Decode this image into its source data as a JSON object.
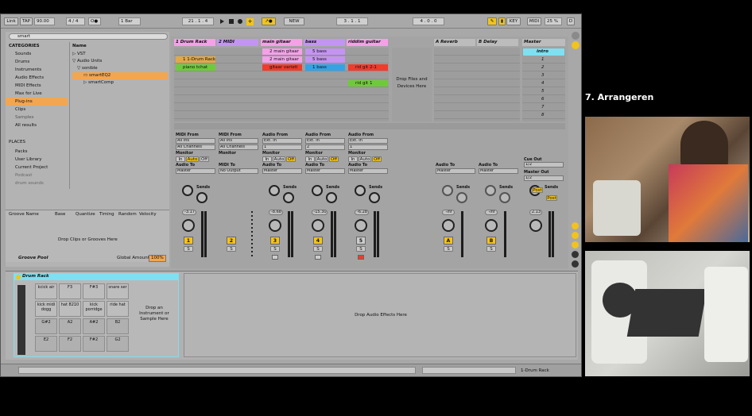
{
  "control_bar": {
    "link": "Link",
    "tap": "TAP",
    "tempo": "90.00",
    "signature": "4 / 4",
    "metronome": "O●",
    "quantize": "1 Bar",
    "position": "21 . 1 . 4",
    "loop_start": "3 . 1 . 1",
    "loop_len": "4 . 0 . 0",
    "new": "NEW",
    "key": "KEY",
    "midi": "MIDI",
    "cpu": "25 %",
    "d": "D"
  },
  "browser": {
    "search": "smart",
    "categories_header": "CATEGORIES",
    "categories": [
      "Sounds",
      "Drums",
      "Instruments",
      "Audio Effects",
      "MIDI Effects",
      "Max for Live",
      "Plug-ins",
      "Clips",
      "Samples",
      "All results"
    ],
    "selected_category": "Plug-ins",
    "places_header": "PLACES",
    "places": [
      "Packs",
      "User Library",
      "Current Project",
      "Podcast",
      "drum sounds"
    ],
    "name_header": "Name",
    "tree": [
      "▷ VST",
      "▽ Audio Units",
      "▽ sonible",
      "smartEQ2",
      "▷ smartComp"
    ],
    "selected_item": "smartEQ2"
  },
  "groove": {
    "headers": [
      "Groove Name",
      "Base",
      "Quantize",
      "Timing",
      "Random",
      "Velocity"
    ],
    "hint": "Drop Clips or Grooves Here",
    "pool": "Groove Pool",
    "global_amount": "Global Amount",
    "amount": "100%"
  },
  "tracks": [
    {
      "name": "1 Drum Rack",
      "color": "#f4a1e8",
      "clips": [
        "",
        "1 1-Drum Rack",
        "piano tchat",
        "",
        "",
        "",
        "",
        "",
        "",
        "",
        ""
      ],
      "clip_colors": [
        "",
        "#e0a848",
        "#6fca3a"
      ],
      "io_from": "All Ins",
      "channel": "All Channels",
      "to": "Master",
      "number": "1",
      "volume": "-3.17"
    },
    {
      "name": "2 MIDI",
      "color": "#c494f2",
      "clips": [],
      "io_from": "All Ins",
      "channel": "All Channels",
      "to": "No Output",
      "number": "2",
      "volume": ""
    },
    {
      "name": "main gitaar",
      "color": "#f4a1e8",
      "clips": [
        "2 main gitaar",
        "2 main gitaar",
        "gitaar varieti"
      ],
      "clip_colors": [
        "#f4a1e8",
        "#f4a1e8",
        "#f03b2d"
      ],
      "io_from": "Ext. In",
      "channel": "1",
      "to": "Master",
      "number": "3",
      "volume": "-8.68"
    },
    {
      "name": "bass",
      "color": "#c494f2",
      "clips": [
        "5 bass",
        "5 bass",
        "1 bass"
      ],
      "clip_colors": [
        "#c494f2",
        "#c494f2",
        "#33a3e6"
      ],
      "io_from": "Ext. In",
      "channel": "2",
      "to": "Master",
      "number": "4",
      "volume": "-15.30"
    },
    {
      "name": "riddim guitar",
      "color": "#f4a1e8",
      "clips": [
        "",
        "",
        "rid git 2-1",
        "",
        "rid git 1"
      ],
      "clip_colors": [
        "",
        "",
        "#f03b2d",
        "",
        "#6fca3a"
      ],
      "io_from": "Ext. In",
      "channel": "1",
      "to": "Master",
      "number": "5",
      "volume": "-6.28"
    }
  ],
  "drop_files": "Drop Files and Devices Here",
  "returns": [
    {
      "name": "A Reverb",
      "letter": "A",
      "to": "Master",
      "volume": "-inf"
    },
    {
      "name": "B Delay",
      "letter": "B",
      "to": "Master",
      "volume": "-inf"
    }
  ],
  "master": {
    "name": "Master",
    "scenes": [
      "intro",
      "1",
      "2",
      "3",
      "4",
      "5",
      "6",
      "7",
      "8"
    ],
    "cue_out": "Cue Out",
    "cue_val": "1/2",
    "master_out": "Master Out",
    "master_val": "1/2",
    "volume": "2.13",
    "post": "Post"
  },
  "mixer_labels": {
    "midi_from": "MIDI From",
    "audio_from": "Audio From",
    "monitor": "Monitor",
    "midi_to": "MIDI To",
    "audio_to": "Audio To",
    "in": "In",
    "auto": "Auto",
    "off": "Off",
    "sends": "Sends",
    "s": "S"
  },
  "drum_rack": {
    "title": "Drum Rack",
    "pads": [
      [
        "kcick air",
        "F3",
        "F#3",
        "snare ser"
      ],
      [
        "kick midi dogg",
        "hat 8210",
        "kick porridge",
        "ride hat"
      ],
      [
        "G#2",
        "A2",
        "A#2",
        "B2"
      ],
      [
        "E2",
        "F2",
        "F#2",
        "G2"
      ]
    ],
    "drop_instrument": "Drop an Instrument or Sample Here",
    "drop_effects": "Drop Audio Effects Here"
  },
  "status": {
    "device": "1-Drum Rack"
  },
  "right_panel": {
    "heading": "7. Arrangeren"
  }
}
